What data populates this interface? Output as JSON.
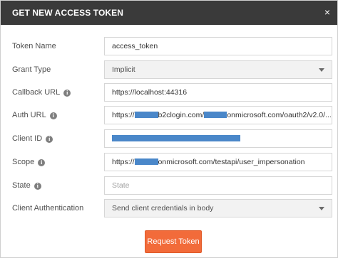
{
  "dialog": {
    "title": "GET NEW ACCESS TOKEN",
    "close": "×"
  },
  "fields": {
    "token_name": {
      "label": "Token Name",
      "value": "access_token"
    },
    "grant_type": {
      "label": "Grant Type",
      "value": "Implicit"
    },
    "callback_url": {
      "label": "Callback URL",
      "value": "https://localhost:44316"
    },
    "auth_url": {
      "label": "Auth URL",
      "value_prefix": "https://",
      "value_middle1": "b2clogin.com/",
      "value_middle2": "onmicrosoft.com/oauth2/v2.0/..."
    },
    "client_id": {
      "label": "Client ID"
    },
    "scope": {
      "label": "Scope",
      "value_prefix": "https://",
      "value_suffix": "onmicrosoft.com/testapi/user_impersonation"
    },
    "state": {
      "label": "State",
      "placeholder": "State"
    },
    "client_auth": {
      "label": "Client Authentication",
      "value": "Send client credentials in body"
    }
  },
  "info_icon_glyph": "i",
  "redaction_color": "#4a87c9",
  "accent_color": "#f26b3a",
  "submit_label": "Request Token"
}
